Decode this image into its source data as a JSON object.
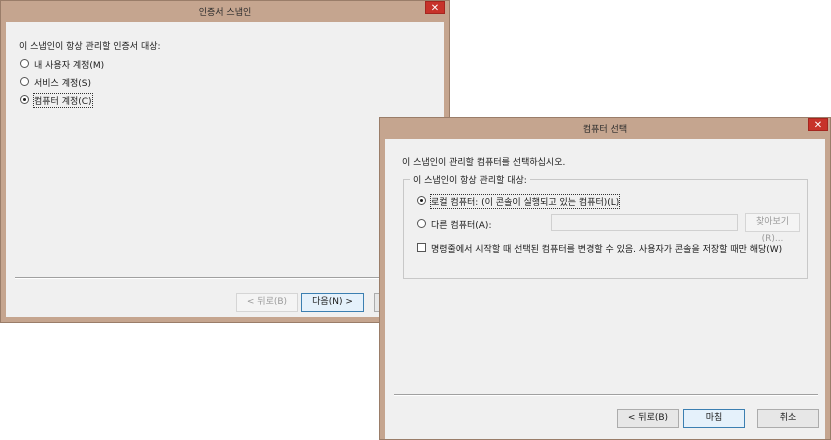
{
  "back_window": {
    "title": "인증서 스냅인",
    "close_label": "✕",
    "prompt": "이 스냅인이 항상 관리할 인증서 대상:",
    "options": [
      {
        "label": "내 사용자 계정(M)",
        "selected": false
      },
      {
        "label": "서비스 계정(S)",
        "selected": false
      },
      {
        "label": "컴퓨터 계정(C)",
        "selected": true
      }
    ],
    "buttons": {
      "back": "< 뒤로(B)",
      "next": "다음(N) >"
    }
  },
  "front_window": {
    "title": "컴퓨터 선택",
    "close_label": "✕",
    "prompt": "이 스냅인이 관리할 컴퓨터를 선택하십시오.",
    "group_title": "이 스냅인이 항상 관리할 대상:",
    "local_option": "로컬 컴퓨터: (이 콘솔이 실행되고 있는 컴퓨터)(L)",
    "other_option": "다른 컴퓨터(A):",
    "other_value": "",
    "browse_button": "찾아보기(R)...",
    "checkbox_label": "명령줄에서 시작할 때 선택된 컴퓨터를 변경할 수 있음. 사용자가 콘솔을 저장할 때만 해당(W)",
    "checkbox_checked": false,
    "buttons": {
      "back": "< 뒤로(B)",
      "finish": "마침",
      "cancel": "취소"
    }
  }
}
